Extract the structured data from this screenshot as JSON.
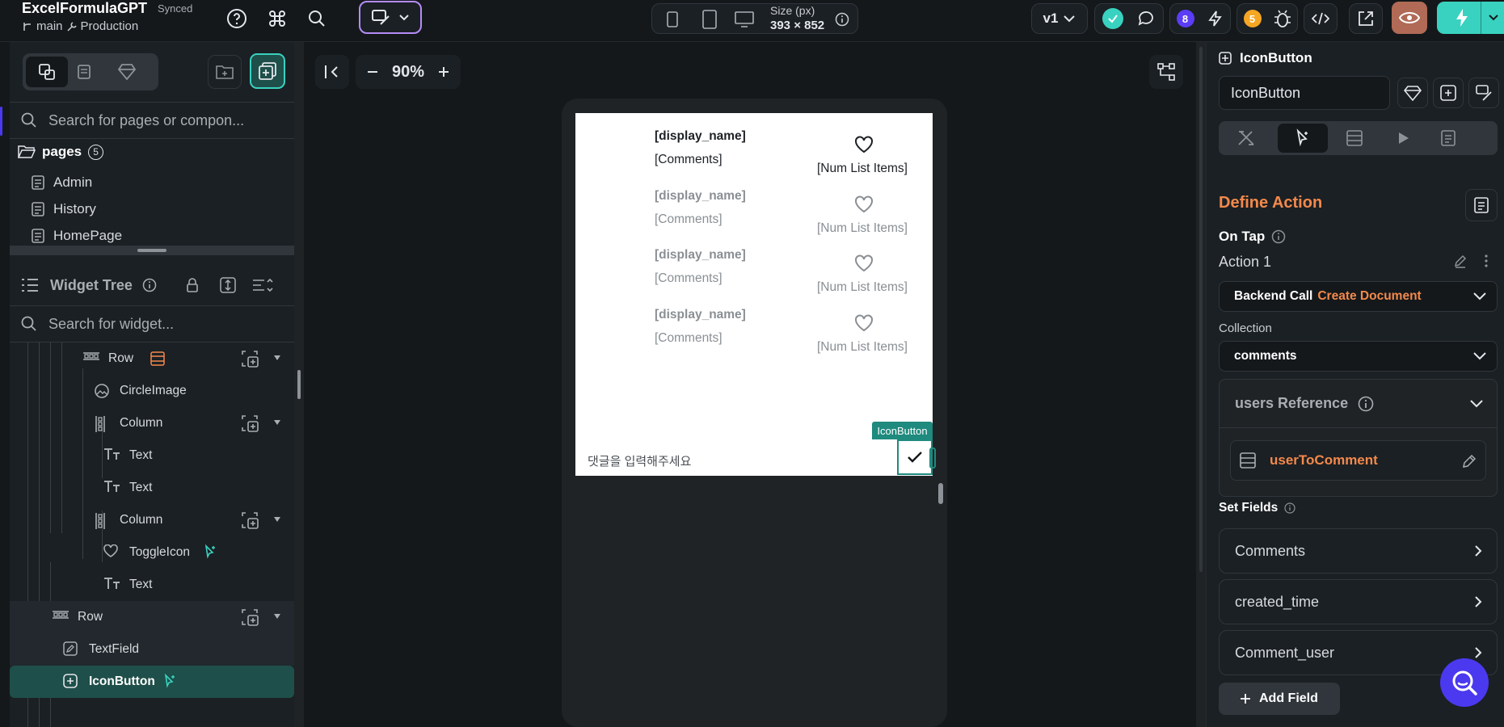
{
  "app": {
    "project_name": "ExcelFormulaGPT",
    "sync_status": "Synced",
    "branch": "main",
    "environment": "Production"
  },
  "topbar": {
    "size_label": "Size (px)",
    "size_value": "393 × 852",
    "version": "v1",
    "badge_purple": "8",
    "badge_orange": "5",
    "accent_purple": "#5b3df5",
    "accent_orange": "#f5a623",
    "accent_teal": "#39d2c0"
  },
  "left": {
    "search_pages_placeholder": "Search for pages or compon...",
    "pages_label": "pages",
    "pages_count": "5",
    "pages": [
      "Admin",
      "History",
      "HomePage"
    ],
    "widget_tree_title": "Widget Tree",
    "search_widget_placeholder": "Search for widget...",
    "tree": [
      {
        "label": "Row",
        "icon": "row-icon"
      },
      {
        "label": "CircleImage",
        "icon": "circle-image-icon"
      },
      {
        "label": "Column",
        "icon": "column-icon"
      },
      {
        "label": "Text",
        "icon": "text-icon"
      },
      {
        "label": "Text",
        "icon": "text-icon"
      },
      {
        "label": "Column",
        "icon": "column-icon"
      },
      {
        "label": "ToggleIcon",
        "icon": "heart-icon"
      },
      {
        "label": "Text",
        "icon": "text-icon"
      },
      {
        "label": "Row",
        "icon": "row-icon"
      },
      {
        "label": "TextField",
        "icon": "text-field-icon"
      },
      {
        "label": "IconButton",
        "icon": "icon-button-icon"
      }
    ]
  },
  "canvas": {
    "zoom": "90%",
    "comments": [
      {
        "name": "[display_name]",
        "text": "[Comments]",
        "num": "[Num List Items]"
      },
      {
        "name": "[display_name]",
        "text": "[Comments]",
        "num": "[Num List Items]"
      },
      {
        "name": "[display_name]",
        "text": "[Comments]",
        "num": "[Num List Items]"
      },
      {
        "name": "[display_name]",
        "text": "[Comments]",
        "num": "[Num List Items]"
      }
    ],
    "input_placeholder": "댓글을 입력해주세요",
    "selected_widget_tag": "IconButton"
  },
  "right": {
    "widget_type": "IconButton",
    "widget_name": "IconButton",
    "define_action_title": "Define Action",
    "trigger_label": "On Tap",
    "action_label": "Action 1",
    "action_type": "Backend Call",
    "action_subtype": "Create Document",
    "collection_label": "Collection",
    "collection_value": "comments",
    "reference_label": "users Reference",
    "reference_value": "userToComment",
    "set_fields_label": "Set Fields",
    "fields": [
      "Comments",
      "created_time",
      "Comment_user"
    ],
    "add_field_label": "Add Field",
    "accent_orange": "#f4894b"
  }
}
